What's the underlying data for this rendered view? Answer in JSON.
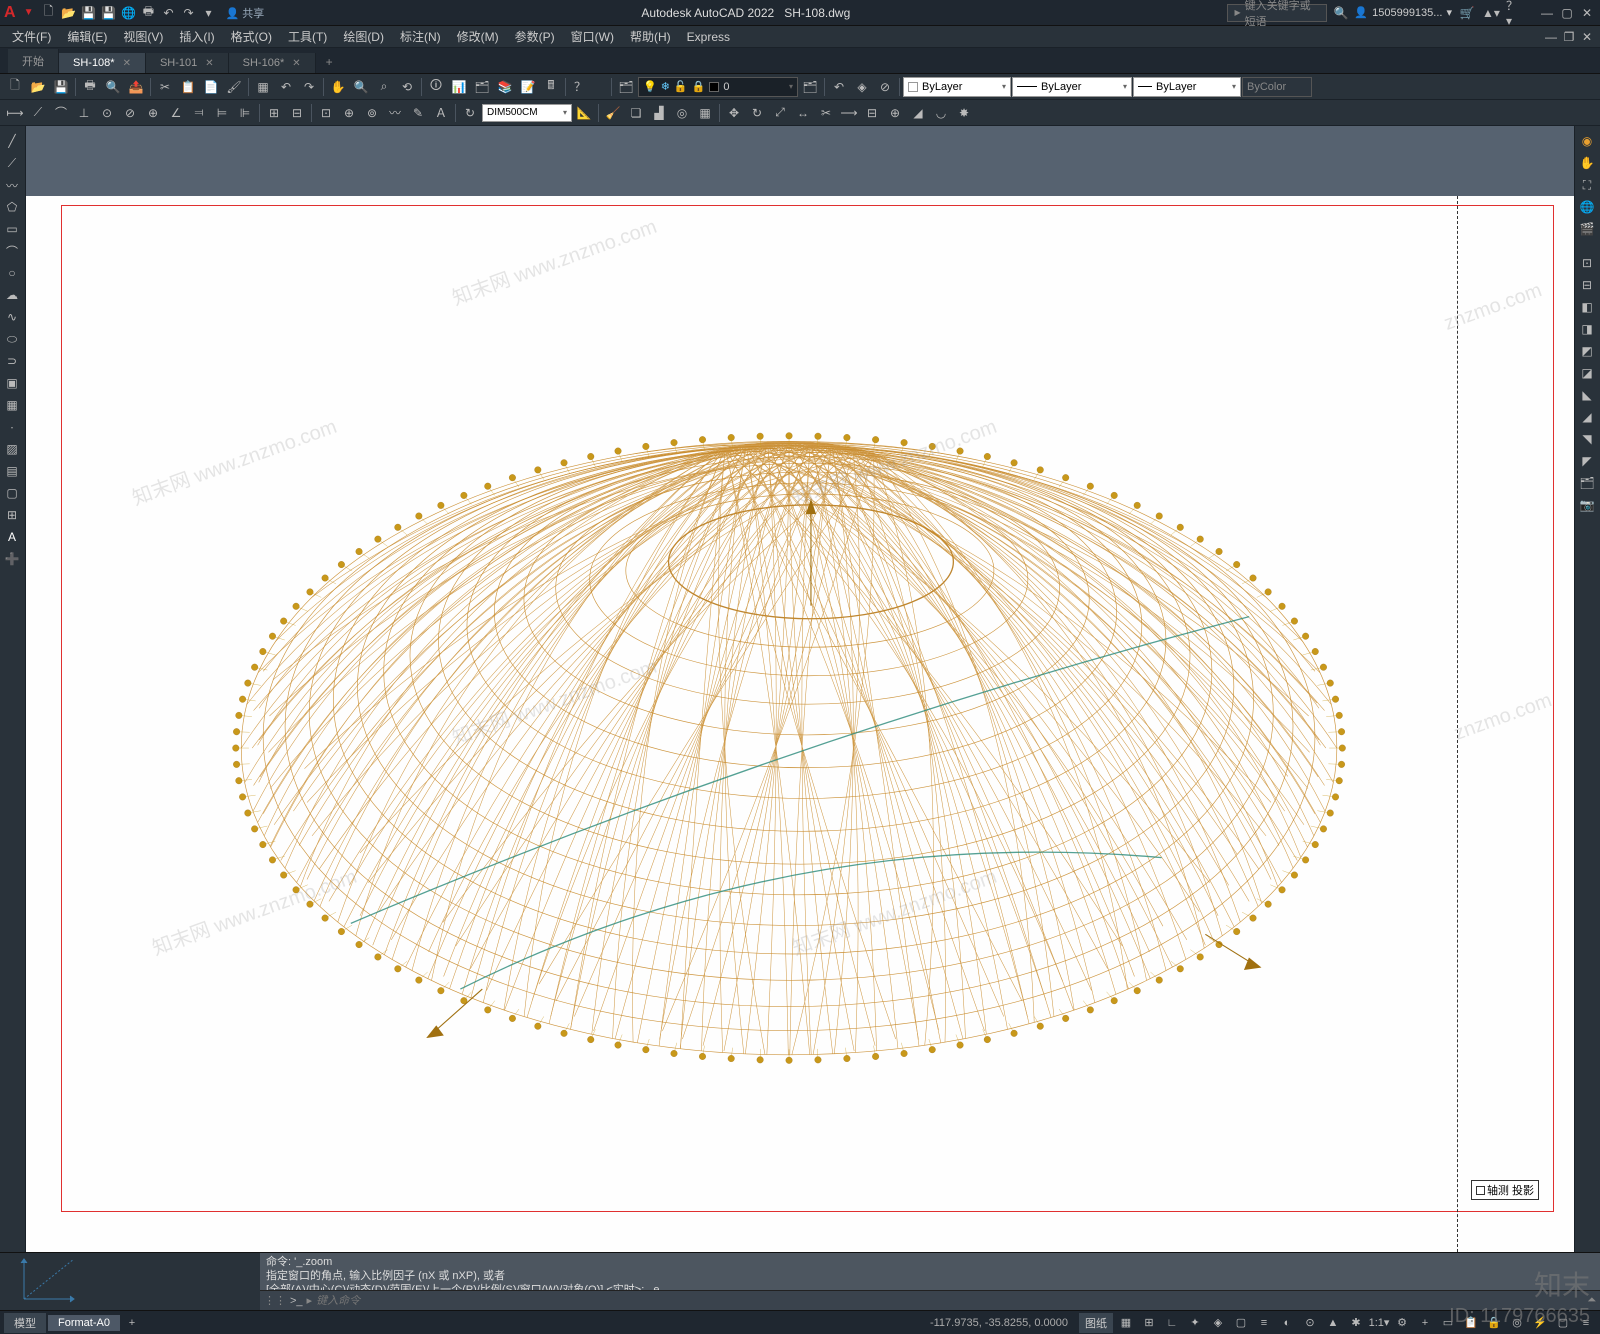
{
  "titlebar": {
    "app_title": "Autodesk AutoCAD 2022",
    "filename": "SH-108.dwg",
    "share_label": "共享",
    "search_placeholder": "键入关键字或短语",
    "username": "1505999135...",
    "logo": "A"
  },
  "menubar": {
    "items": [
      {
        "label": "文件(F)"
      },
      {
        "label": "编辑(E)"
      },
      {
        "label": "视图(V)"
      },
      {
        "label": "插入(I)"
      },
      {
        "label": "格式(O)"
      },
      {
        "label": "工具(T)"
      },
      {
        "label": "绘图(D)"
      },
      {
        "label": "标注(N)"
      },
      {
        "label": "修改(M)"
      },
      {
        "label": "参数(P)"
      },
      {
        "label": "窗口(W)"
      },
      {
        "label": "帮助(H)"
      },
      {
        "label": "Express"
      }
    ]
  },
  "filetabs": {
    "tabs": [
      {
        "label": "开始",
        "active": false,
        "closable": false
      },
      {
        "label": "SH-108*",
        "active": true,
        "closable": true
      },
      {
        "label": "SH-101",
        "active": false,
        "closable": true
      },
      {
        "label": "SH-106*",
        "active": false,
        "closable": true
      }
    ]
  },
  "layer": {
    "current_layer": "0",
    "color_prop": "ByLayer",
    "linetype_prop": "ByLayer",
    "lineweight_prop": "ByLayer",
    "plotstyle_prop": "ByColor"
  },
  "dim": {
    "style": "DIM500CM"
  },
  "drawing": {
    "label_text": "轴测 投影"
  },
  "commandline": {
    "history": [
      "命令: '_.zoom",
      "指定窗口的角点, 输入比例因子 (nX 或 nXP), 或者",
      "[全部(A)/中心(C)/动态(D)/范围(E)/上一个(P)/比例(S)/窗口(W)/对象(O)] <实时>: _e"
    ],
    "prompt_icon": ">_",
    "input_placeholder": "键入命令"
  },
  "statusbar": {
    "layout_tabs": [
      {
        "label": "模型",
        "active": false
      },
      {
        "label": "Format-A0",
        "active": true
      }
    ],
    "coords": "-117.9735, -35.8255, 0.0000",
    "paper_label": "图纸"
  },
  "watermark": {
    "text": "知末网 www.znzmo.com",
    "logo": "知末",
    "id_label": "ID: 1179766635"
  }
}
